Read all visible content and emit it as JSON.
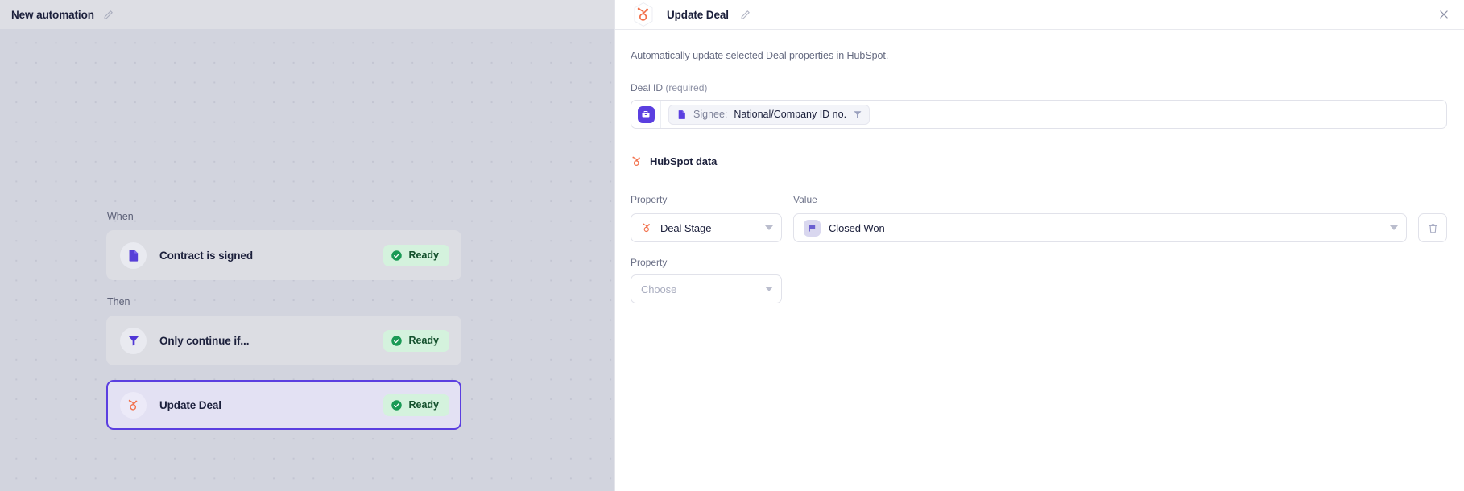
{
  "left": {
    "topbar": {
      "title": "New automation",
      "edit_icon": "pencil-icon"
    },
    "flow": {
      "when_label": "When",
      "then_label": "Then",
      "ready_label": "Ready",
      "cards": [
        {
          "title": "Contract is signed",
          "status": "Ready",
          "icon": "document-signed-icon",
          "selected": false
        },
        {
          "title": "Only continue if...",
          "status": "Ready",
          "icon": "filter-icon",
          "selected": false
        },
        {
          "title": "Update Deal",
          "status": "Ready",
          "icon": "hubspot-icon",
          "selected": true
        }
      ]
    }
  },
  "panel": {
    "header": {
      "icon": "hubspot-icon",
      "title": "Update Deal",
      "edit_icon": "pencil-icon",
      "close_icon": "close-icon"
    },
    "description": "Automatically update selected Deal properties in HubSpot.",
    "deal_id": {
      "label": "Deal ID",
      "required_suffix": "(required)",
      "leading_icon": "briefcase-icon",
      "token": {
        "icon": "document-icon",
        "prefix": "Signee:",
        "text": "National/Company ID no.",
        "trailing_icon": "funnel-icon"
      },
      "input_placeholder": ""
    },
    "section": {
      "icon": "hubspot-icon",
      "title": "HubSpot data"
    },
    "columns": {
      "property": "Property",
      "value": "Value"
    },
    "rows": [
      {
        "property": {
          "icon": "hubspot-icon",
          "text": "Deal Stage",
          "placeholder": "Choose"
        },
        "value": {
          "icon": "flag-icon",
          "text": "Closed Won",
          "placeholder": "Choose"
        },
        "delete_icon": "trash-icon",
        "has_value": true
      },
      {
        "property": {
          "icon": "",
          "text": "",
          "placeholder": "Choose"
        },
        "value": null,
        "delete_icon": "",
        "has_value": false
      }
    ],
    "second_property_label": "Property"
  },
  "colors": {
    "accent_purple": "#5b3fe0",
    "hubspot_orange": "#f2714c",
    "ready_green_bg": "#d4f2dd",
    "ready_green_text": "#13502c",
    "canvas_bg": "#d2d4de"
  }
}
